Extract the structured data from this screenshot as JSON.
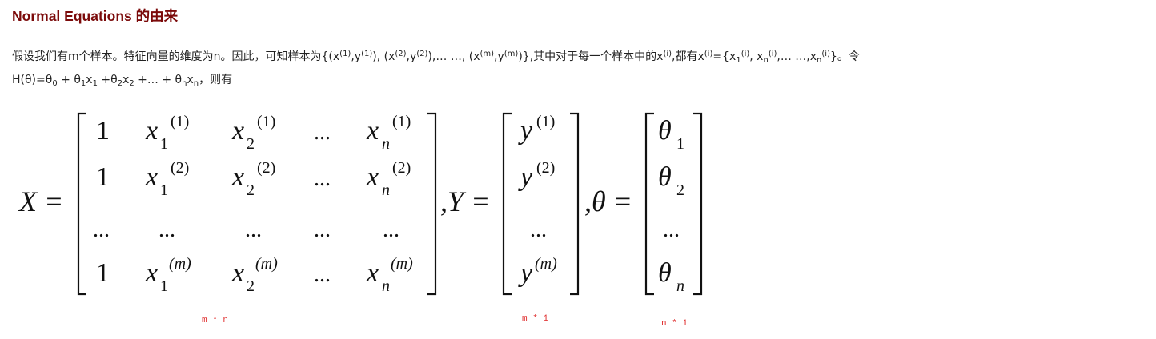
{
  "heading": "Normal Equations 的由来",
  "paragraph": {
    "l1_a": "假设我们有m个样本。特征向量的维度为n。因此，可知样本为{(x",
    "l1_s1": "(1)",
    "l1_b": ",y",
    "l1_s2": "(1)",
    "l1_c": "), (x",
    "l1_s3": "(2)",
    "l1_d": ",y",
    "l1_s4": "(2)",
    "l1_e": "),… …, (x",
    "l1_s5": "(m)",
    "l1_f": ",y",
    "l1_s6": "(m)",
    "l1_g": ")},其中对于每一个样本中的x",
    "l1_s7": "(i)",
    "l1_h": ",都有x",
    "l1_s8": "(i)",
    "l1_i": "={x",
    "l1_sub1": "1",
    "l1_s9": "(i)",
    "l1_j": ", x",
    "l1_sub2": "n",
    "l1_s10": "(i)",
    "l1_k": ",… …,x",
    "l1_sub3": "n",
    "l1_s11": "(i)",
    "l1_l": "}。令",
    "l2_a": "H(θ)=θ",
    "l2_sub0": "0",
    "l2_b": " + θ",
    "l2_sub1": "1",
    "l2_c": "x",
    "l2_sub1b": "1",
    "l2_d": " +θ",
    "l2_sub2": "2",
    "l2_e": "x",
    "l2_sub2b": "2",
    "l2_f": " +… + θ",
    "l2_subn": "n",
    "l2_g": "x",
    "l2_subnb": "n",
    "l2_h": "，则有"
  },
  "formula": {
    "X_lhs": "X =",
    "Y_lhs": ",Y =",
    "theta_lhs": ",θ =",
    "x_rows": [
      [
        "1",
        "x",
        "1",
        "(1)",
        "x",
        "2",
        "(1)",
        "...",
        "x",
        "n",
        "(1)"
      ],
      [
        "1",
        "x",
        "1",
        "(2)",
        "x",
        "2",
        "(2)",
        "...",
        "x",
        "n",
        "(2)"
      ],
      [
        "...",
        "...",
        "...",
        "...",
        "..."
      ],
      [
        "1",
        "x",
        "1",
        "(m)",
        "x",
        "2",
        "(m)",
        "...",
        "x",
        "n",
        "(m)"
      ]
    ],
    "y_rows": [
      [
        "y",
        "(1)"
      ],
      [
        "y",
        "(2)"
      ],
      [
        "..."
      ],
      [
        "y",
        "(m)"
      ]
    ],
    "theta_rows": [
      [
        "θ",
        "1"
      ],
      [
        "θ",
        "2"
      ],
      [
        "..."
      ],
      [
        "θ",
        "n"
      ]
    ]
  },
  "dimensions": {
    "x": "m * n",
    "y": "m * 1",
    "theta": "n * 1"
  }
}
